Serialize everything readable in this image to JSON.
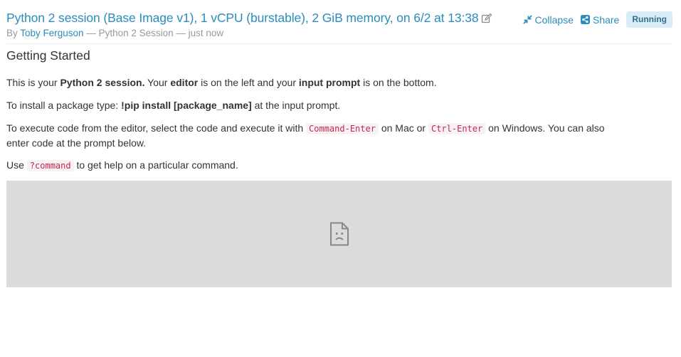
{
  "header": {
    "title": "Python 2 session (Base Image v1), 1 vCPU (burstable), 2 GiB memory, on 6/2 at 13:38",
    "by_prefix": "By ",
    "author": "Toby Ferguson",
    "meta": " — Python 2 Session — just now",
    "collapse_label": "Collapse",
    "share_label": "Share",
    "status": "Running",
    "icons": [
      "edit-icon",
      "collapse-icon",
      "share-icon"
    ]
  },
  "content": {
    "section_title": "Getting Started",
    "p1": {
      "t1": "This is your ",
      "b1": "Python 2 session.",
      "t2": " Your ",
      "b2": "editor",
      "t3": " is on the left and your ",
      "b3": "input prompt",
      "t4": " is on the bottom."
    },
    "p2": {
      "t1": "To install a package type: ",
      "b1": "!pip install [package_name]",
      "t2": " at the input prompt."
    },
    "p3": {
      "t1": "To execute code from the editor, select the code and execute it with ",
      "c1": "Command-Enter",
      "t2": " on Mac or ",
      "c2": "Ctrl-Enter",
      "t3": " on Windows. You can also enter code at the prompt below."
    },
    "p4": {
      "t1": "Use ",
      "c1": "?command",
      "t2": " to get help on a particular command."
    },
    "embed_icon": "broken-document-icon"
  }
}
